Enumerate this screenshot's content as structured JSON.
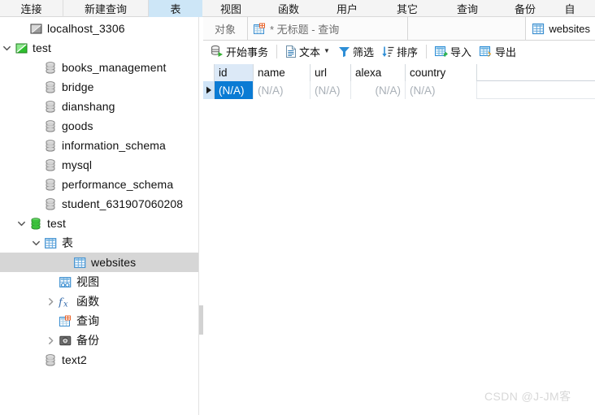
{
  "ribbon": {
    "tabs": [
      {
        "label": "连接",
        "icon": "connection-icon",
        "active": false
      },
      {
        "label": "新建查询",
        "icon": "new-query-icon",
        "active": false
      },
      {
        "label": "表",
        "icon": "table-icon",
        "active": true
      },
      {
        "label": "视图",
        "icon": "view-icon",
        "active": false
      },
      {
        "label": "函数",
        "icon": "function-icon",
        "active": false
      },
      {
        "label": "用户",
        "icon": "user-icon",
        "active": false
      },
      {
        "label": "其它",
        "icon": "other-icon",
        "active": false
      },
      {
        "label": "查询",
        "icon": "query-icon",
        "active": false
      },
      {
        "label": "备份",
        "icon": "backup-icon",
        "active": false
      },
      {
        "label": "自",
        "icon": "automation-icon",
        "active": false
      }
    ]
  },
  "sidebar": {
    "items": [
      {
        "label": "localhost_3306",
        "icon": "connection-icon",
        "indent": 1,
        "twisty": "none",
        "selected": false
      },
      {
        "label": "test",
        "icon": "connection-icon-green",
        "indent": 0,
        "twisty": "down",
        "selected": false
      },
      {
        "label": "books_management",
        "icon": "database-icon",
        "indent": 2,
        "twisty": "none",
        "selected": false
      },
      {
        "label": "bridge",
        "icon": "database-icon",
        "indent": 2,
        "twisty": "none",
        "selected": false
      },
      {
        "label": "dianshang",
        "icon": "database-icon",
        "indent": 2,
        "twisty": "none",
        "selected": false
      },
      {
        "label": "goods",
        "icon": "database-icon",
        "indent": 2,
        "twisty": "none",
        "selected": false
      },
      {
        "label": "information_schema",
        "icon": "database-icon",
        "indent": 2,
        "twisty": "none",
        "selected": false
      },
      {
        "label": "mysql",
        "icon": "database-icon",
        "indent": 2,
        "twisty": "none",
        "selected": false
      },
      {
        "label": "performance_schema",
        "icon": "database-icon",
        "indent": 2,
        "twisty": "none",
        "selected": false
      },
      {
        "label": "student_631907060208",
        "icon": "database-icon",
        "indent": 2,
        "twisty": "none",
        "selected": false
      },
      {
        "label": "test",
        "icon": "database-icon-green",
        "indent": 1,
        "twisty": "down",
        "selected": false
      },
      {
        "label": "表",
        "icon": "table-icon",
        "indent": 2,
        "twisty": "down",
        "selected": false
      },
      {
        "label": "websites",
        "icon": "table-icon",
        "indent": 4,
        "twisty": "none",
        "selected": true
      },
      {
        "label": "视图",
        "icon": "view-icon",
        "indent": 3,
        "twisty": "none",
        "selected": false
      },
      {
        "label": "函数",
        "icon": "fx-icon",
        "indent": 3,
        "twisty": "right",
        "selected": false
      },
      {
        "label": "查询",
        "icon": "query-icon",
        "indent": 3,
        "twisty": "none",
        "selected": false
      },
      {
        "label": "备份",
        "icon": "backup-icon",
        "indent": 3,
        "twisty": "right",
        "selected": false
      },
      {
        "label": "text2",
        "icon": "database-icon",
        "indent": 2,
        "twisty": "none",
        "selected": false
      }
    ]
  },
  "main": {
    "tabs": [
      {
        "label": "对象",
        "icon": "none",
        "name": "tab-objects"
      },
      {
        "label": "* 无标题 - 查询",
        "icon": "query-icon",
        "name": "tab-untitled-query"
      },
      {
        "label": "websites",
        "icon": "table-icon",
        "name": "tab-websites"
      }
    ],
    "toolbar": [
      {
        "label": "开始事务",
        "icon": "begin-transaction-icon",
        "caret": false
      },
      {
        "label": "文本",
        "icon": "text-icon",
        "caret": true
      },
      {
        "label": "筛选",
        "icon": "filter-icon",
        "caret": false
      },
      {
        "label": "排序",
        "icon": "sort-icon",
        "caret": false
      },
      {
        "label": "导入",
        "icon": "import-icon",
        "caret": false
      },
      {
        "label": "导出",
        "icon": "export-icon",
        "caret": false
      }
    ],
    "grid": {
      "columns": [
        {
          "label": "id",
          "width": 48,
          "align": "left",
          "highlighted": true
        },
        {
          "label": "name",
          "width": 70,
          "align": "left",
          "highlighted": false
        },
        {
          "label": "url",
          "width": 50,
          "align": "left",
          "highlighted": false
        },
        {
          "label": "alexa",
          "width": 67,
          "align": "right",
          "highlighted": false
        },
        {
          "label": "country",
          "width": 88,
          "align": "left",
          "highlighted": false
        }
      ],
      "rows": [
        {
          "current": true,
          "cells": [
            {
              "value": "(N/A)",
              "selected": true
            },
            {
              "value": "(N/A)",
              "selected": false
            },
            {
              "value": "(N/A)",
              "selected": false
            },
            {
              "value": "(N/A)",
              "selected": false
            },
            {
              "value": "(N/A)",
              "selected": false
            }
          ]
        }
      ]
    }
  },
  "watermark": {
    "text": "CSDN @J-JM客"
  },
  "colors": {
    "accent": "#0b7bd4",
    "tab_active": "#cde6f7",
    "selection_row": "#d6d6d6",
    "header_highlight": "#dce9f7",
    "null_text": "#a9b0b7"
  }
}
